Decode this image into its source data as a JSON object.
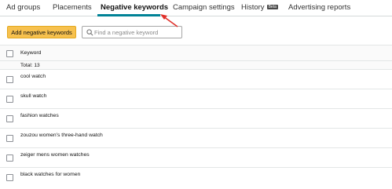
{
  "tabs": [
    {
      "label": "Ad groups",
      "active": false
    },
    {
      "label": "Placements",
      "active": false
    },
    {
      "label": "Negative keywords",
      "active": true
    },
    {
      "label": "Campaign settings",
      "active": false
    },
    {
      "label": "History",
      "active": false,
      "badge": "Beta"
    },
    {
      "label": "Advertising reports",
      "active": false
    }
  ],
  "toolbar": {
    "add_button_label": "Add negative keywords",
    "search_placeholder": "Find a negative keyword"
  },
  "table": {
    "column_header": "Keyword",
    "total_label": "Total: 13",
    "rows": [
      "cool watch",
      "skull watch",
      "fashion watches",
      "zouzou women's three-hand watch",
      "zeiger mens women watches",
      "black watches for women"
    ]
  },
  "colors": {
    "accent_underline": "#008296",
    "add_button": "#f7c14e",
    "annotation_arrow": "#e0302a"
  }
}
